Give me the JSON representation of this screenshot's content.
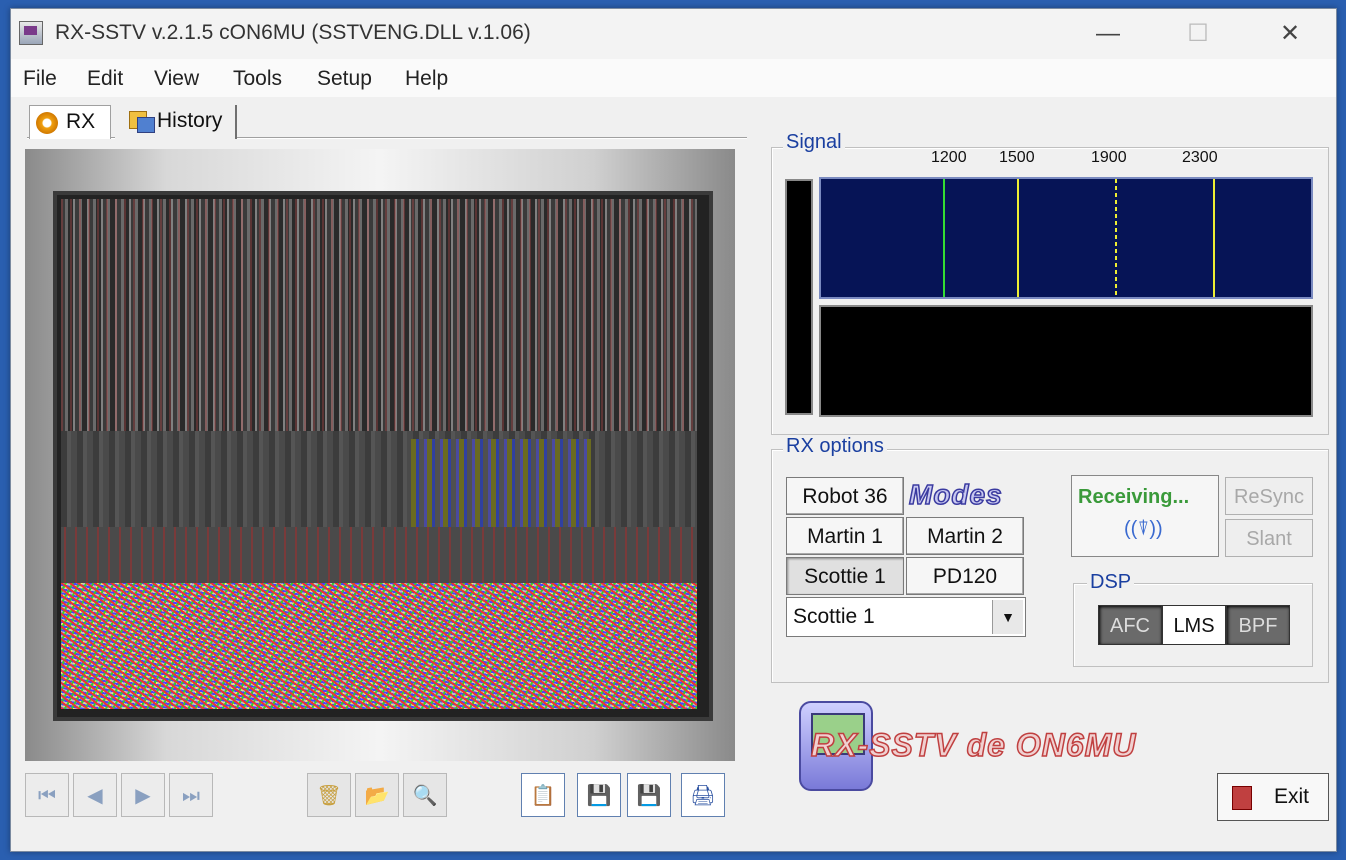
{
  "window": {
    "title": "RX-SSTV v.2.1.5 cON6MU (SSTVENG.DLL v.1.06)"
  },
  "window_controls": {
    "minimize": "—",
    "maximize": "☐",
    "close": "✕"
  },
  "menu": [
    "File",
    "Edit",
    "View",
    "Tools",
    "Setup",
    "Help"
  ],
  "tabs": {
    "rx": "RX",
    "history": "History"
  },
  "signal": {
    "label": "Signal",
    "freq_marks": [
      "1200",
      "1500",
      "1900",
      "2300"
    ],
    "colors": {
      "spectrum_bg": "#061456",
      "marker_1200": "#33dd33",
      "marker_other": "#eeee33"
    }
  },
  "rx_options": {
    "label": "RX options",
    "mode_buttons": [
      "Robot 36",
      "Martin 1",
      "Martin 2",
      "Scottie 1",
      "PD120"
    ],
    "modes_logo": "Modes",
    "selected_mode": "Scottie 1",
    "status": "Receiving...",
    "resync": "ReSync",
    "slant": "Slant"
  },
  "dsp": {
    "label": "DSP",
    "afc": "AFC",
    "lms": "LMS",
    "bpf": "BPF"
  },
  "brand": "RX-SSTV de ON6MU",
  "exit": "Exit",
  "toolbar": {
    "first": "⏮",
    "prev": "◀",
    "next": "▶",
    "last": "⏭",
    "delete": "🗑",
    "open": "📂",
    "zoom": "🔍",
    "copy": "📋",
    "save": "💾",
    "save_all": "💾",
    "print": "🖨"
  }
}
